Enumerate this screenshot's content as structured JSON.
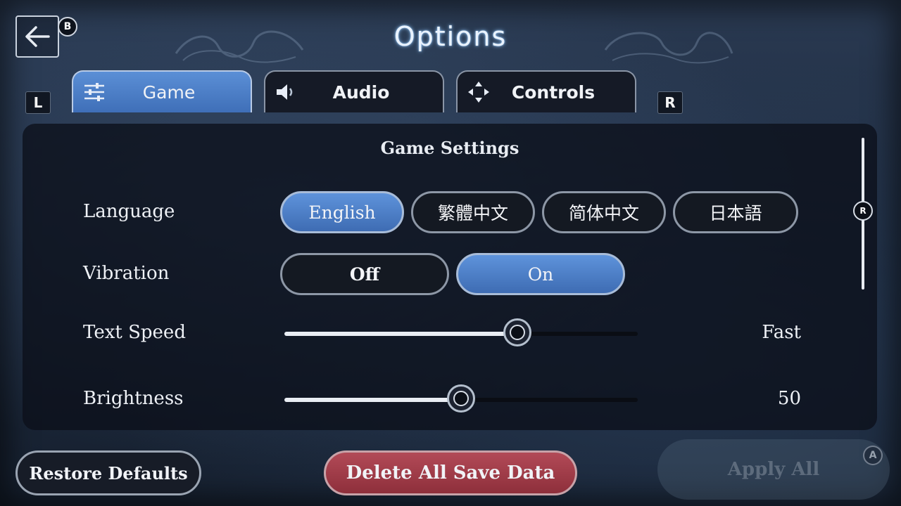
{
  "header": {
    "title": "Options",
    "back_badge": "B"
  },
  "shoulders": {
    "left": "L",
    "right": "R"
  },
  "tabs": [
    {
      "label": "Game",
      "icon": "sliders-icon",
      "active": true
    },
    {
      "label": "Audio",
      "icon": "speaker-icon",
      "active": false
    },
    {
      "label": "Controls",
      "icon": "dpad-icon",
      "active": false
    }
  ],
  "panel": {
    "title": "Game Settings",
    "language": {
      "label": "Language",
      "options": [
        "English",
        "繁體中文",
        "简体中文",
        "日本語"
      ],
      "selected": "English"
    },
    "vibration": {
      "label": "Vibration",
      "options": [
        "Off",
        "On"
      ],
      "selected": "On"
    },
    "text_speed": {
      "label": "Text Speed",
      "value_label": "Fast",
      "level": 0.66
    },
    "brightness": {
      "label": "Brightness",
      "value": "50",
      "level": 0.5
    },
    "scroll_badge": "R"
  },
  "footer": {
    "restore_label": "Restore Defaults",
    "delete_label": "Delete All Save Data",
    "apply_label": "Apply All",
    "apply_badge": "A"
  },
  "colors": {
    "selected_blue": "#4f82cc",
    "delete_red": "#a23f4c",
    "panel_bg": "#0c101a"
  }
}
